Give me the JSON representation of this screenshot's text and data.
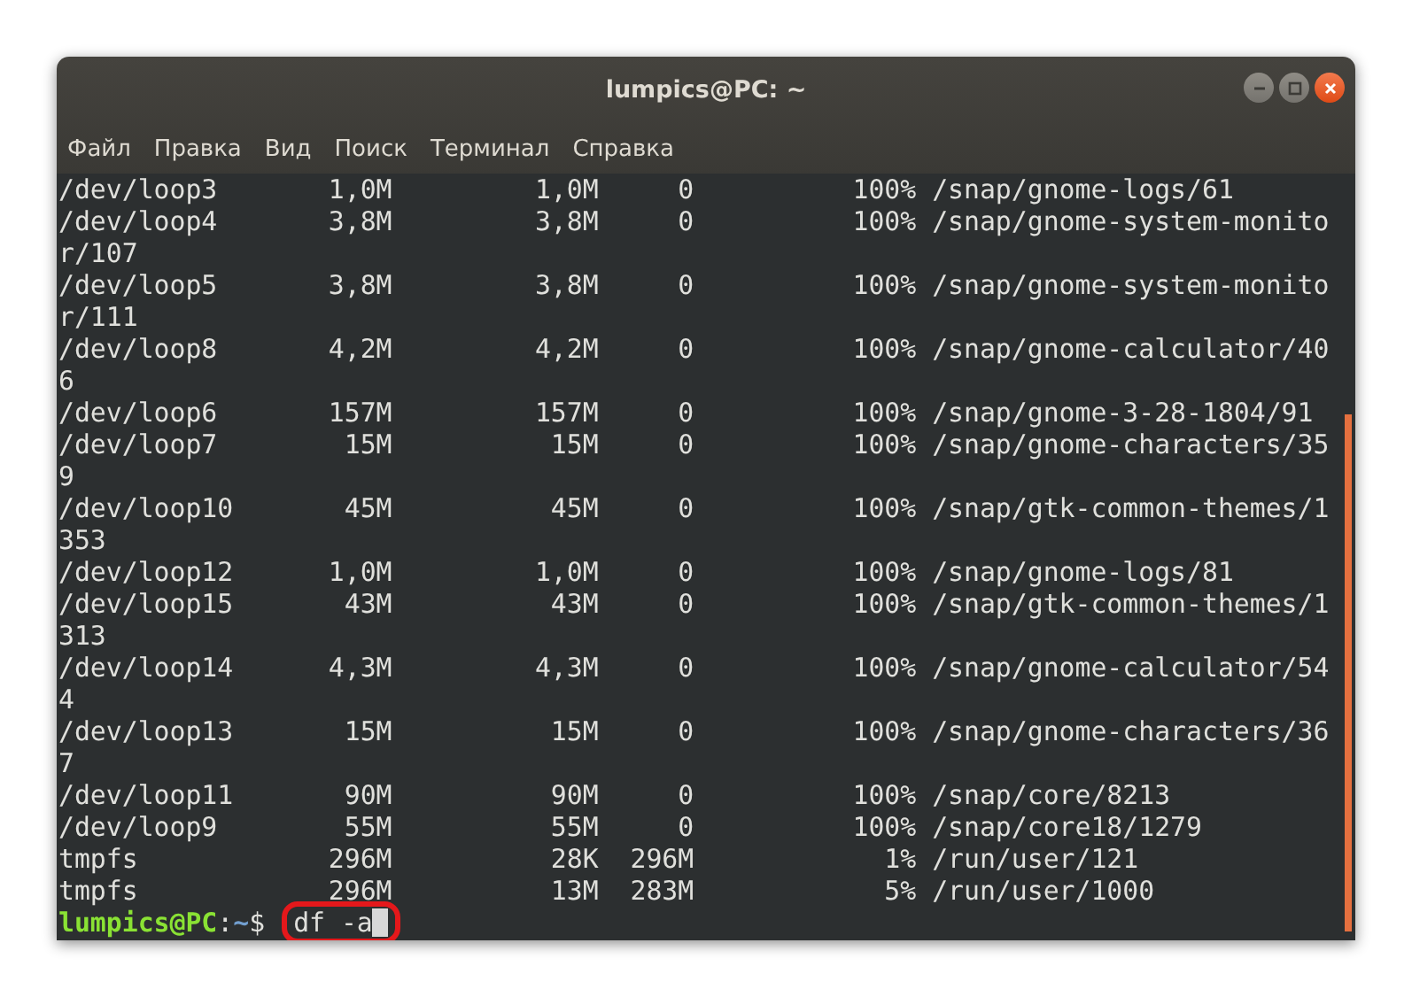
{
  "window": {
    "title": "lumpics@PC: ~"
  },
  "menu": [
    {
      "label": "Файл"
    },
    {
      "label": "Правка"
    },
    {
      "label": "Вид"
    },
    {
      "label": "Поиск"
    },
    {
      "label": "Терминал"
    },
    {
      "label": "Справка"
    }
  ],
  "output_lines": [
    "/dev/loop3       1,0M         1,0M     0          100% /snap/gnome-logs/61",
    "/dev/loop4       3,8M         3,8M     0          100% /snap/gnome-system-monito",
    "r/107",
    "/dev/loop5       3,8M         3,8M     0          100% /snap/gnome-system-monito",
    "r/111",
    "/dev/loop8       4,2M         4,2M     0          100% /snap/gnome-calculator/40",
    "6",
    "/dev/loop6       157M         157M     0          100% /snap/gnome-3-28-1804/91",
    "/dev/loop7        15M          15M     0          100% /snap/gnome-characters/35",
    "9",
    "/dev/loop10       45M          45M     0          100% /snap/gtk-common-themes/1",
    "353",
    "/dev/loop12      1,0M         1,0M     0          100% /snap/gnome-logs/81",
    "/dev/loop15       43M          43M     0          100% /snap/gtk-common-themes/1",
    "313",
    "/dev/loop14      4,3M         4,3M     0          100% /snap/gnome-calculator/54",
    "4",
    "/dev/loop13       15M          15M     0          100% /snap/gnome-characters/36",
    "7",
    "/dev/loop11       90M          90M     0          100% /snap/core/8213",
    "/dev/loop9        55M          55M     0          100% /snap/core18/1279",
    "tmpfs            296M          28K  296M            1% /run/user/121",
    "tmpfs            296M          13M  283M            5% /run/user/1000"
  ],
  "prompt": {
    "user_host": "lumpics@PC",
    "separator": ":",
    "path": "~",
    "symbol": "$",
    "command": "df -a",
    "highlighted": true
  }
}
